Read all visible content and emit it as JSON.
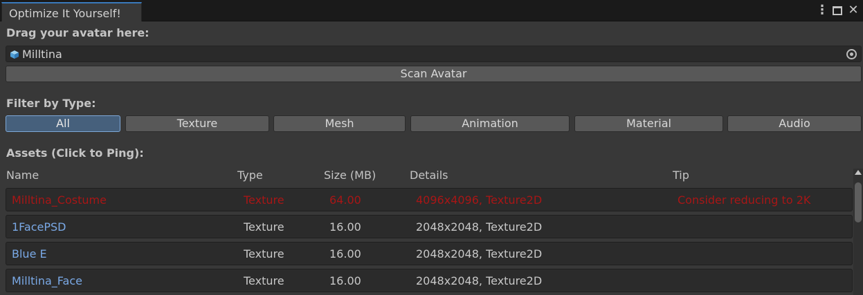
{
  "window": {
    "tab_title": "Optimize It Yourself!"
  },
  "avatar": {
    "drag_label": "Drag your avatar here:",
    "field_value": "Milltina",
    "scan_label": "Scan Avatar"
  },
  "filter": {
    "label": "Filter by Type:",
    "buttons": [
      {
        "label": "All",
        "selected": true
      },
      {
        "label": "Texture",
        "selected": false
      },
      {
        "label": "Mesh",
        "selected": false
      },
      {
        "label": "Animation",
        "selected": false
      },
      {
        "label": "Material",
        "selected": false
      },
      {
        "label": "Audio",
        "selected": false
      }
    ]
  },
  "assets": {
    "label": "Assets (Click to Ping):",
    "columns": [
      "Name",
      "Type",
      "Size (MB)",
      "Details",
      "Tip"
    ],
    "rows": [
      {
        "name": "Milltina_Costume",
        "type": "Texture",
        "size": "64.00",
        "details": "4096x4096, Texture2D",
        "tip": "Consider reducing to 2K",
        "warning": true
      },
      {
        "name": "1FacePSD",
        "type": "Texture",
        "size": "16.00",
        "details": "2048x2048, Texture2D",
        "tip": "",
        "warning": false
      },
      {
        "name": "Blue E",
        "type": "Texture",
        "size": "16.00",
        "details": "2048x2048, Texture2D",
        "tip": "",
        "warning": false
      },
      {
        "name": "Milltina_Face",
        "type": "Texture",
        "size": "16.00",
        "details": "2048x2048, Texture2D",
        "tip": "",
        "warning": false
      }
    ]
  },
  "colors": {
    "accent": "#3a79bb",
    "selected_filter": "#46607c",
    "asset_link": "#7aa9e6",
    "warning_text": "#a81616"
  },
  "icons": {
    "avatar_field": "cube-icon",
    "object_picker": "object-picker-icon",
    "menu": "kebab-menu-icon",
    "maximize": "maximize-icon",
    "close": "close-icon"
  }
}
